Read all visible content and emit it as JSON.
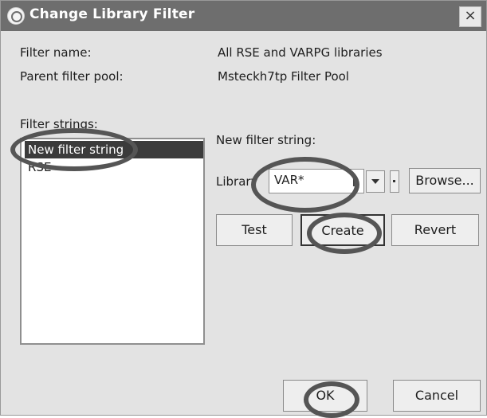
{
  "window": {
    "title": "Change Library Filter",
    "close_glyph": "×"
  },
  "fields": {
    "filter_name_label": "Filter name:",
    "filter_name_value": "All RSE and VARPG libraries",
    "parent_pool_label": "Parent filter pool:",
    "parent_pool_value": "Msteckh7tp Filter Pool"
  },
  "filter_strings": {
    "label": "Filter strings:",
    "items": [
      "New filter string",
      "RSE"
    ],
    "selected_index": 0
  },
  "editor": {
    "new_filter_label": "New filter string:",
    "library_label": "Library",
    "library_value": "VAR*",
    "browse_label": "Browse..."
  },
  "actions": {
    "test": "Test",
    "create": "Create",
    "revert": "Revert"
  },
  "footer": {
    "ok": "OK",
    "cancel": "Cancel"
  },
  "colors": {
    "title_bar": "#6e6e6e",
    "dialog_bg": "#e3e3e3",
    "selection": "#3b3b3b",
    "annotation_oval": "#555555"
  },
  "icons": {
    "title": "eclipse-dialog-icon",
    "dropdown": "chevron-down-icon",
    "text_cursor": "ibeam-cursor-icon"
  }
}
